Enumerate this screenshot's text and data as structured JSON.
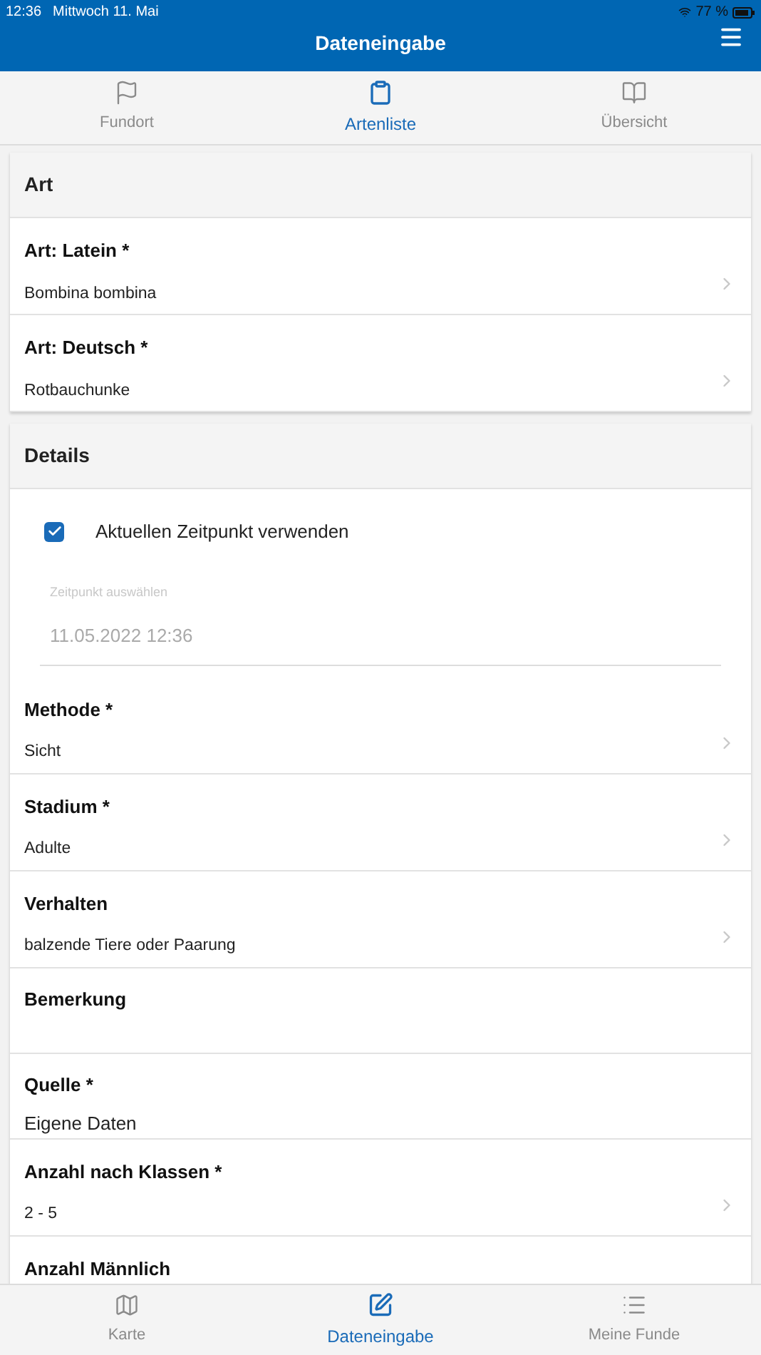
{
  "status_bar": {
    "time": "12:36",
    "date": "Mittwoch 11. Mai",
    "battery": "77 %"
  },
  "header": {
    "title": "Dateneingabe"
  },
  "top_tabs": [
    {
      "label": "Fundort",
      "selected": false
    },
    {
      "label": "Artenliste",
      "selected": true
    },
    {
      "label": "Übersicht",
      "selected": false
    }
  ],
  "sections": [
    {
      "title": "Art",
      "rows": [
        {
          "kind": "select",
          "label": "Art: Latein *",
          "value": "Bombina bombina"
        },
        {
          "kind": "select",
          "label": "Art: Deutsch *",
          "value": "Rotbauchunke"
        }
      ]
    },
    {
      "title": "Details",
      "rows": [
        {
          "kind": "checkbox",
          "label": "Aktuellen Zeitpunkt verwenden",
          "checked": true
        },
        {
          "kind": "datetime",
          "label": "Zeitpunkt auswählen",
          "value": "11.05.2022 12:36",
          "disabled": true
        },
        {
          "kind": "select",
          "label": "Methode *",
          "value": "Sicht"
        },
        {
          "kind": "select",
          "label": "Stadium *",
          "value": "Adulte"
        },
        {
          "kind": "select",
          "label": "Verhalten",
          "value": "balzende Tiere oder Paarung"
        },
        {
          "kind": "text",
          "label": "Bemerkung"
        },
        {
          "kind": "text",
          "label": "Quelle *",
          "value": "Eigene Daten"
        },
        {
          "kind": "select",
          "label": "Anzahl nach Klassen *",
          "value": "2 - 5"
        },
        {
          "kind": "select",
          "label": "Anzahl Männlich"
        }
      ]
    }
  ],
  "bottom_tabs": [
    {
      "label": "Karte",
      "selected": false
    },
    {
      "label": "Dateneingabe",
      "selected": true
    },
    {
      "label": "Meine Funde",
      "selected": false
    }
  ]
}
